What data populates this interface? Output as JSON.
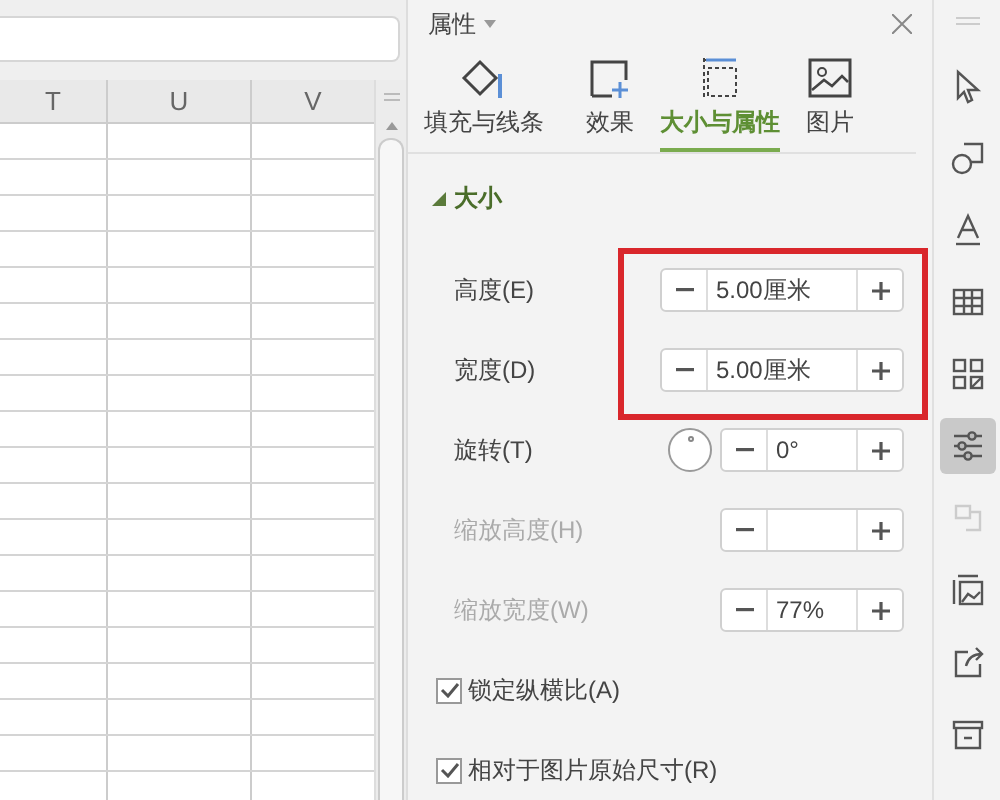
{
  "sheet": {
    "columns": [
      {
        "label": "T"
      },
      {
        "label": "U"
      },
      {
        "label": "V"
      }
    ]
  },
  "panel": {
    "title": "属性",
    "tabs": [
      {
        "label": "填充与线条",
        "selected": false
      },
      {
        "label": "效果",
        "selected": false
      },
      {
        "label": "大小与属性",
        "selected": true
      },
      {
        "label": "图片",
        "selected": false
      }
    ],
    "section": {
      "title": "大小",
      "expanded": true
    },
    "rows": [
      {
        "kind": "spinner",
        "label": "高度(E)",
        "value": "5.00厘米",
        "disabled": false,
        "highlighted": true
      },
      {
        "kind": "spinner",
        "label": "宽度(D)",
        "value": "5.00厘米",
        "disabled": false,
        "highlighted": true
      },
      {
        "kind": "dial",
        "label": "旋转(T)",
        "value": "0°",
        "disabled": false
      },
      {
        "kind": "spinner",
        "label": "缩放高度(H)",
        "disabled": true
      },
      {
        "kind": "spinner",
        "label": "缩放宽度(W)",
        "value": "77%",
        "disabled": true
      },
      {
        "kind": "checkbox",
        "label": "锁定纵横比(A)",
        "checked": true
      },
      {
        "kind": "checkbox",
        "label": "相对于图片原始尺寸(R)",
        "checked": true
      }
    ]
  },
  "toolbar": [
    {
      "kind": "cursor",
      "selected": false,
      "disabled": false
    },
    {
      "kind": "shapes",
      "selected": false,
      "disabled": false
    },
    {
      "kind": "text",
      "selected": false,
      "disabled": false
    },
    {
      "kind": "table",
      "selected": false,
      "disabled": false
    },
    {
      "kind": "grid",
      "selected": false,
      "disabled": false
    },
    {
      "kind": "sliders",
      "selected": true,
      "disabled": false
    },
    {
      "kind": "flow",
      "selected": false,
      "disabled": true
    },
    {
      "kind": "image",
      "selected": false,
      "disabled": false
    },
    {
      "kind": "share",
      "selected": false,
      "disabled": false
    },
    {
      "kind": "archive",
      "selected": false,
      "disabled": false
    }
  ]
}
